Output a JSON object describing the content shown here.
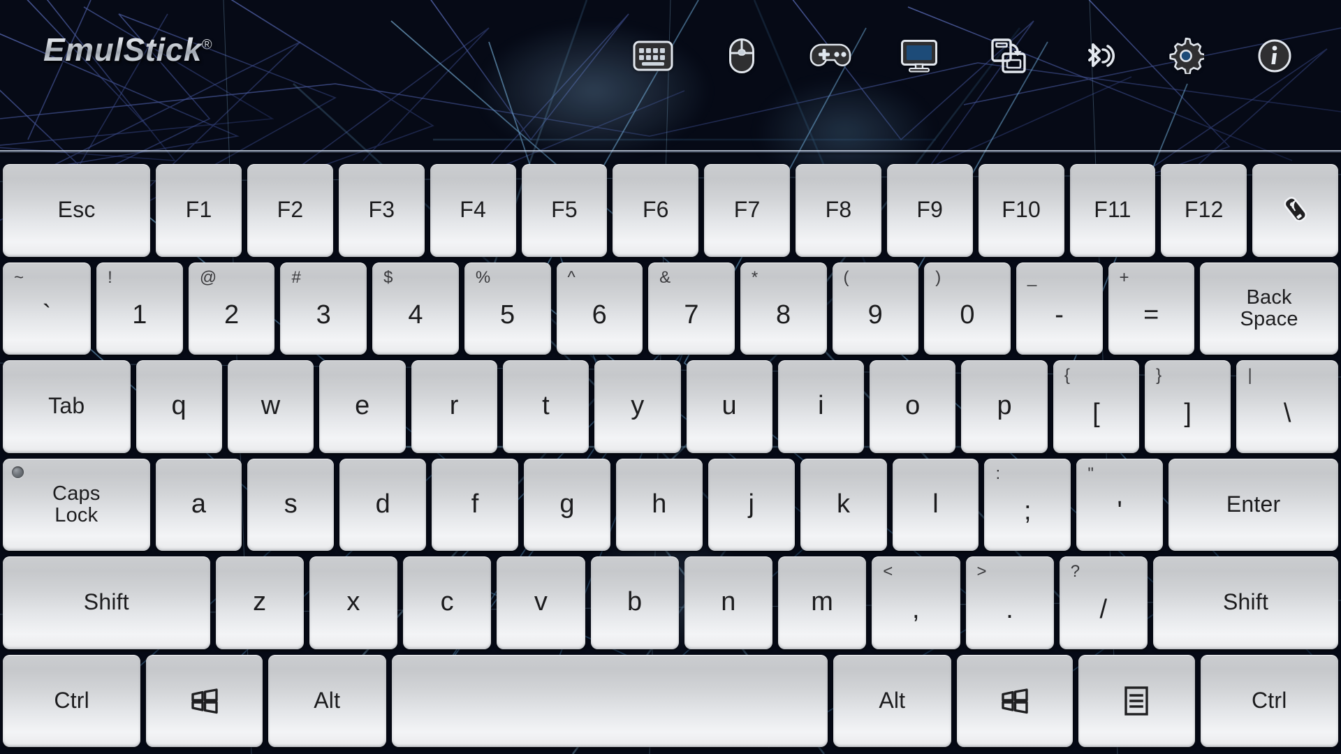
{
  "app": {
    "name": "EmulStick",
    "trademark": "®"
  },
  "toolbar": {
    "items": [
      {
        "name": "keyboard-icon",
        "label": "Keyboard"
      },
      {
        "name": "mouse-icon",
        "label": "Mouse"
      },
      {
        "name": "gamepad-icon",
        "label": "Gamepad"
      },
      {
        "name": "display-icon",
        "label": "Display"
      },
      {
        "name": "save-icon",
        "label": "Save / Macro"
      },
      {
        "name": "bluetooth-icon",
        "label": "Bluetooth"
      },
      {
        "name": "settings-icon",
        "label": "Settings"
      },
      {
        "name": "info-icon",
        "label": "Info"
      }
    ]
  },
  "keyboard": {
    "rows": [
      {
        "name": "function-row",
        "keys": [
          {
            "name": "key-escape",
            "main": "Esc",
            "size": "f-esc"
          },
          {
            "name": "key-f1",
            "main": "F1",
            "size": "f-fn"
          },
          {
            "name": "key-f2",
            "main": "F2",
            "size": "f-fn"
          },
          {
            "name": "key-f3",
            "main": "F3",
            "size": "f-fn"
          },
          {
            "name": "key-f4",
            "main": "F4",
            "size": "f-fn"
          },
          {
            "name": "key-f5",
            "main": "F5",
            "size": "f-fn"
          },
          {
            "name": "key-f6",
            "main": "F6",
            "size": "f-fn"
          },
          {
            "name": "key-f7",
            "main": "F7",
            "size": "f-fn"
          },
          {
            "name": "key-f8",
            "main": "F8",
            "size": "f-fn"
          },
          {
            "name": "key-f9",
            "main": "F9",
            "size": "f-fn"
          },
          {
            "name": "key-f10",
            "main": "F10",
            "size": "f-fn"
          },
          {
            "name": "key-f11",
            "main": "F11",
            "size": "f-fn"
          },
          {
            "name": "key-f12",
            "main": "F12",
            "size": "f-fn"
          },
          {
            "name": "key-dongle",
            "main": "",
            "size": "f-dong",
            "icon": "usb-dongle-icon"
          }
        ]
      },
      {
        "name": "number-row",
        "keys": [
          {
            "name": "key-backquote",
            "main": "`",
            "shifted": "~",
            "size": "f-tilde"
          },
          {
            "name": "key-1",
            "main": "1",
            "shifted": "!",
            "size": "f-num"
          },
          {
            "name": "key-2",
            "main": "2",
            "shifted": "@",
            "size": "f-num"
          },
          {
            "name": "key-3",
            "main": "3",
            "shifted": "#",
            "size": "f-num"
          },
          {
            "name": "key-4",
            "main": "4",
            "shifted": "$",
            "size": "f-num"
          },
          {
            "name": "key-5",
            "main": "5",
            "shifted": "%",
            "size": "f-num"
          },
          {
            "name": "key-6",
            "main": "6",
            "shifted": "^",
            "size": "f-num"
          },
          {
            "name": "key-7",
            "main": "7",
            "shifted": "&",
            "size": "f-num"
          },
          {
            "name": "key-8",
            "main": "8",
            "shifted": "*",
            "size": "f-num"
          },
          {
            "name": "key-9",
            "main": "9",
            "shifted": "(",
            "size": "f-num"
          },
          {
            "name": "key-0",
            "main": "0",
            "shifted": ")",
            "size": "f-num"
          },
          {
            "name": "key-minus",
            "main": "-",
            "shifted": "_",
            "size": "f-num"
          },
          {
            "name": "key-equal",
            "main": "=",
            "shifted": "+",
            "size": "f-num"
          },
          {
            "name": "key-backspace",
            "main": "Back\nSpace",
            "size": "f-bksp",
            "multiline": true
          }
        ]
      },
      {
        "name": "top-letter-row",
        "keys": [
          {
            "name": "key-tab",
            "main": "Tab",
            "size": "f-tab"
          },
          {
            "name": "key-q",
            "main": "q",
            "size": "f-ltr"
          },
          {
            "name": "key-w",
            "main": "w",
            "size": "f-ltr"
          },
          {
            "name": "key-e",
            "main": "e",
            "size": "f-ltr"
          },
          {
            "name": "key-r",
            "main": "r",
            "size": "f-ltr"
          },
          {
            "name": "key-t",
            "main": "t",
            "size": "f-ltr"
          },
          {
            "name": "key-y",
            "main": "y",
            "size": "f-ltr"
          },
          {
            "name": "key-u",
            "main": "u",
            "size": "f-ltr"
          },
          {
            "name": "key-i",
            "main": "i",
            "size": "f-ltr"
          },
          {
            "name": "key-o",
            "main": "o",
            "size": "f-ltr"
          },
          {
            "name": "key-p",
            "main": "p",
            "size": "f-ltr"
          },
          {
            "name": "key-bracket-left",
            "main": "[",
            "shifted": "{",
            "size": "f-ltr"
          },
          {
            "name": "key-bracket-right",
            "main": "]",
            "shifted": "}",
            "size": "f-ltr"
          },
          {
            "name": "key-backslash",
            "main": "\\",
            "shifted": "|",
            "size": "f-bslash"
          }
        ]
      },
      {
        "name": "home-row",
        "keys": [
          {
            "name": "key-caps-lock",
            "main": "Caps\nLock",
            "size": "f-caps",
            "multiline": true,
            "led": true
          },
          {
            "name": "key-a",
            "main": "a",
            "size": "f-ltr"
          },
          {
            "name": "key-s",
            "main": "s",
            "size": "f-ltr"
          },
          {
            "name": "key-d",
            "main": "d",
            "size": "f-ltr"
          },
          {
            "name": "key-f",
            "main": "f",
            "size": "f-ltr"
          },
          {
            "name": "key-g",
            "main": "g",
            "size": "f-ltr"
          },
          {
            "name": "key-h",
            "main": "h",
            "size": "f-ltr"
          },
          {
            "name": "key-j",
            "main": "j",
            "size": "f-ltr"
          },
          {
            "name": "key-k",
            "main": "k",
            "size": "f-ltr"
          },
          {
            "name": "key-l",
            "main": "l",
            "size": "f-ltr"
          },
          {
            "name": "key-semicolon",
            "main": ";",
            "shifted": ":",
            "size": "f-ltr"
          },
          {
            "name": "key-quote",
            "main": "'",
            "shifted": "\"",
            "size": "f-ltr"
          },
          {
            "name": "key-enter",
            "main": "Enter",
            "size": "f-enter"
          }
        ]
      },
      {
        "name": "bottom-letter-row",
        "keys": [
          {
            "name": "key-shift-left",
            "main": "Shift",
            "size": "f-shiftL"
          },
          {
            "name": "key-z",
            "main": "z",
            "size": "f-ltr"
          },
          {
            "name": "key-x",
            "main": "x",
            "size": "f-ltr"
          },
          {
            "name": "key-c",
            "main": "c",
            "size": "f-ltr"
          },
          {
            "name": "key-v",
            "main": "v",
            "size": "f-ltr"
          },
          {
            "name": "key-b",
            "main": "b",
            "size": "f-ltr"
          },
          {
            "name": "key-n",
            "main": "n",
            "size": "f-ltr"
          },
          {
            "name": "key-m",
            "main": "m",
            "size": "f-ltr"
          },
          {
            "name": "key-comma",
            "main": ",",
            "shifted": "<",
            "size": "f-ltr"
          },
          {
            "name": "key-period",
            "main": ".",
            "shifted": ">",
            "size": "f-ltr"
          },
          {
            "name": "key-slash",
            "main": "/",
            "shifted": "?",
            "size": "f-ltr"
          },
          {
            "name": "key-shift-right",
            "main": "Shift",
            "size": "f-shiftR"
          }
        ]
      },
      {
        "name": "modifier-row",
        "keys": [
          {
            "name": "key-ctrl-left",
            "main": "Ctrl",
            "size": "f-ctrl"
          },
          {
            "name": "key-win-left",
            "main": "",
            "size": "f-win",
            "icon": "windows-icon"
          },
          {
            "name": "key-alt-left",
            "main": "Alt",
            "size": "f-alt"
          },
          {
            "name": "key-space",
            "main": "",
            "size": "f-space"
          },
          {
            "name": "key-alt-right",
            "main": "Alt",
            "size": "f-alt"
          },
          {
            "name": "key-win-right",
            "main": "",
            "size": "f-win",
            "icon": "windows-icon"
          },
          {
            "name": "key-menu",
            "main": "",
            "size": "f-menu",
            "icon": "menu-icon"
          },
          {
            "name": "key-ctrl-right",
            "main": "Ctrl",
            "size": "f-ctrl"
          }
        ]
      }
    ]
  },
  "colors": {
    "background_dark": "#05070f",
    "background_blue": "#0c2448",
    "key_face": "#d6d8db",
    "key_text": "#1c1c1e",
    "icon_dark": "#2f2f31",
    "icon_outline": "#dfe4ea",
    "rule": "#d7e1f0"
  }
}
